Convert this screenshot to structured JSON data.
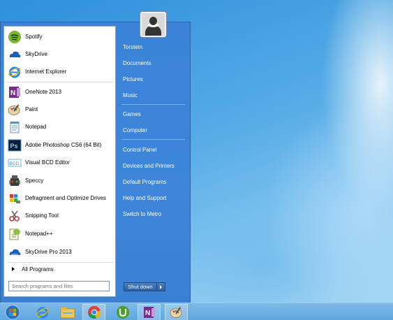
{
  "start_menu": {
    "programs": [
      {
        "label": "Spotify",
        "icon": "spotify-icon"
      },
      {
        "label": "SkyDrive",
        "icon": "skydrive-icon"
      },
      {
        "label": "Internet Explorer",
        "icon": "internet-explorer-icon"
      },
      {
        "label": "OneNote 2013",
        "icon": "onenote-icon"
      },
      {
        "label": "Paint",
        "icon": "paint-icon"
      },
      {
        "label": "Notepad",
        "icon": "notepad-icon"
      },
      {
        "label": "Adobe Photoshop CS6 (64 Bit)",
        "icon": "photoshop-icon"
      },
      {
        "label": "Visual BCD Editor",
        "icon": "bcd-editor-icon"
      },
      {
        "label": "Speccy",
        "icon": "speccy-icon"
      },
      {
        "label": "Defragment and Optimize Drives",
        "icon": "defrag-icon"
      },
      {
        "label": "Snipping Tool",
        "icon": "snipping-tool-icon"
      },
      {
        "label": "Notepad++",
        "icon": "notepad-plus-plus-icon"
      },
      {
        "label": "SkyDrive Pro 2013",
        "icon": "skydrive-pro-icon"
      }
    ],
    "all_programs_label": "All Programs",
    "search_placeholder": "Search programs and files",
    "right_links": [
      "Torstein",
      "Documents",
      "Pictures",
      "Music",
      "Games",
      "Computer",
      "Control Panel",
      "Devices and Printers",
      "Default Programs",
      "Help and Support",
      "Switch to Metro"
    ],
    "shutdown_label": "Shut down"
  },
  "taskbar": {
    "items": [
      "start-orb-icon",
      "internet-explorer-icon",
      "file-explorer-icon",
      "chrome-icon",
      "utorrent-icon",
      "onenote-icon",
      "paint-icon"
    ]
  }
}
